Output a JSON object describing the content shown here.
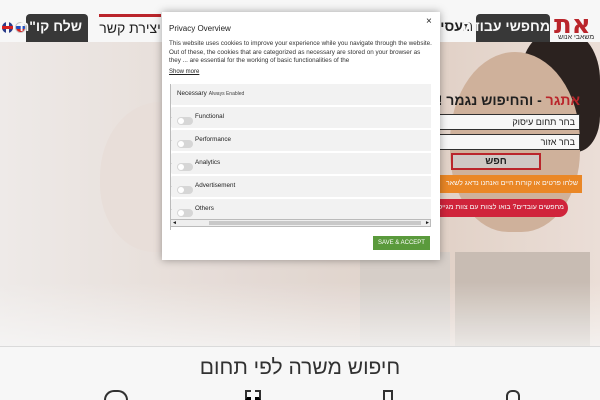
{
  "header": {
    "languages": [
      "English",
      "Russian"
    ],
    "nav": {
      "send_cv": "שלח קו\"ח",
      "contact": "יצירת קשר",
      "employers": "מעסיקים",
      "job_seekers": "מחפשי עבודה"
    },
    "logo": {
      "mark": "את",
      "tagline": "משאבי אנוש"
    }
  },
  "hero": {
    "title_brand": "אתגר",
    "title_rest": " - והחיפוש נגמר !",
    "sector_field": "בחר תחום עיסוק",
    "area_field": "בחר אזור",
    "search_button": "חפש",
    "cta_orange": "שלחו פרטים או קורות חיים ואנחנו נדאג לשאר",
    "cta_red": "מחפשים עובדים? בואו לצוות עם צוות מגייסות לחיזוק"
  },
  "section": {
    "title": "חיפוש משרה לפי תחום"
  },
  "cookie_modal": {
    "title": "Privacy Overview",
    "close": "×",
    "description": "This website uses cookies to improve your experience while you navigate through the website. Out of these, the cookies that are categorized as necessary are stored on your browser as they ... are essential for the working of basic functionalities of the",
    "show_more": "Show more",
    "categories": [
      {
        "label": "Necessary",
        "note": "Always Enabled",
        "toggle": false
      },
      {
        "label": "Functional",
        "note": "",
        "toggle": true
      },
      {
        "label": "Performance",
        "note": "",
        "toggle": true
      },
      {
        "label": "Analytics",
        "note": "",
        "toggle": true
      },
      {
        "label": "Advertisement",
        "note": "",
        "toggle": true
      },
      {
        "label": "Others",
        "note": "",
        "toggle": true
      }
    ],
    "scroll_left": "◄",
    "scroll_right": "►",
    "save_button": "SAVE & ACCEPT",
    "colors": {
      "save": "#5a9a3c",
      "brand_red": "#c1272d",
      "cta_orange": "#f28c28"
    }
  }
}
